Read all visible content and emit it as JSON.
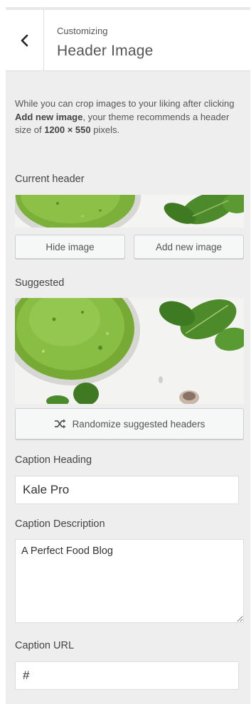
{
  "header": {
    "subtitle": "Customizing",
    "title": "Header Image"
  },
  "description": {
    "part1": "While you can crop images to your liking after clicking ",
    "bold1": "Add new image",
    "part2": ", your theme recommends a header size of ",
    "bold2": "1200 × 550",
    "part3": " pixels."
  },
  "current_header": {
    "label": "Current header",
    "hide_button": "Hide image",
    "add_button": "Add new image"
  },
  "suggested": {
    "label": "Suggested",
    "randomize_button": "Randomize suggested headers"
  },
  "caption_heading": {
    "label": "Caption Heading",
    "value": "Kale Pro"
  },
  "caption_description": {
    "label": "Caption Description",
    "value": "A Perfect Food Blog"
  },
  "caption_url": {
    "label": "Caption URL",
    "value": "#"
  },
  "colors": {
    "panel_bg": "#eeeeee",
    "smoothie_green": "#7fb43a",
    "leaf_green": "#4f8a2a"
  }
}
